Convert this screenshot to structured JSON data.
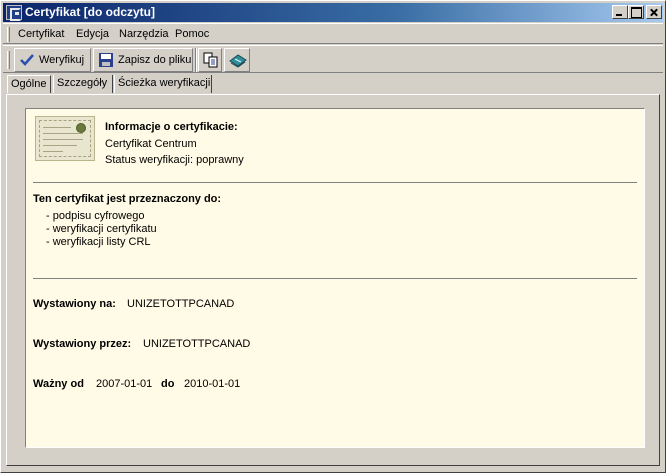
{
  "window": {
    "title": "Certyfikat [do odczytu]",
    "caption_buttons": [
      "minimize",
      "maximize",
      "close"
    ]
  },
  "menu": {
    "items": [
      {
        "label": "Certyfikat"
      },
      {
        "label": "Edycja"
      },
      {
        "label": "Narzędzia"
      },
      {
        "label": "Pomoc"
      }
    ]
  },
  "toolbar": {
    "verify_label": "Weryfikuj",
    "save_label": "Zapisz do pliku",
    "icons": [
      "checkmark-icon",
      "floppy-disk-icon",
      "copy-icon",
      "book-icon"
    ]
  },
  "tabs": [
    {
      "label": "Ogólne",
      "active": true
    },
    {
      "label": "Szczegóły",
      "active": false
    },
    {
      "label": "Ścieżka weryfikacji",
      "active": false
    }
  ],
  "cert": {
    "info_heading": "Informacje o certyfikacie:",
    "name": "Certyfikat Centrum",
    "status": "Status weryfikacji: poprawny",
    "purpose_heading": "Ten certyfikat jest przeznaczony do:",
    "purposes": [
      "- podpisu cyfrowego",
      "- weryfikacji certyfikatu",
      "- weryfikacji listy CRL"
    ],
    "issued_to_label": "Wystawiony na:",
    "issued_to_value": "UNIZETOTTPCANAD",
    "issued_by_label": "Wystawiony przez:",
    "issued_by_value": "UNIZETOTTPCANAD",
    "valid_from_label": "Ważny od",
    "valid_from_value": "2007-01-01",
    "valid_to_label": "do",
    "valid_to_value": "2010-01-01"
  },
  "colors": {
    "titlebar_start": "#0a246a",
    "titlebar_end": "#a6caf0",
    "cert_background": "#fffbe6",
    "face": "#d4d0c8"
  }
}
